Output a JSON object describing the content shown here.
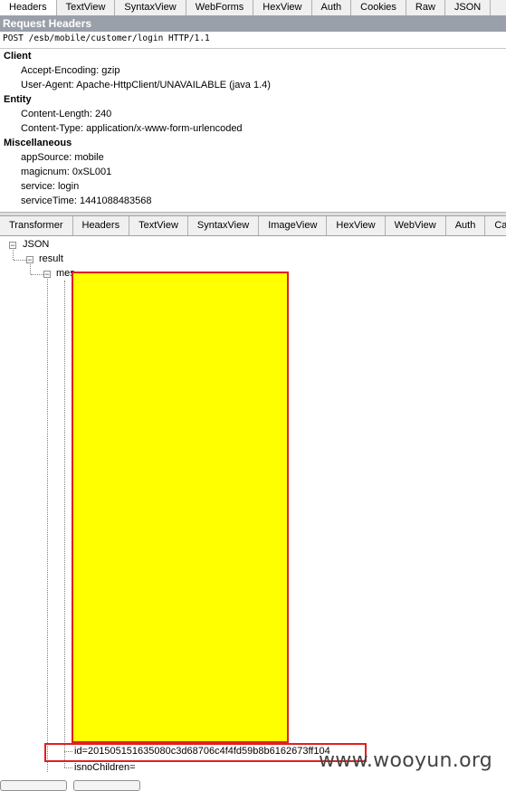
{
  "top_tabs": [
    "Headers",
    "TextView",
    "SyntaxView",
    "WebForms",
    "HexView",
    "Auth",
    "Cookies",
    "Raw",
    "JSON"
  ],
  "request_headers": {
    "title": "Request Headers",
    "request_line": "POST /esb/mobile/customer/login HTTP/1.1",
    "groups": [
      {
        "name": "Client",
        "items": [
          "Accept-Encoding: gzip",
          "User-Agent: Apache-HttpClient/UNAVAILABLE (java 1.4)"
        ]
      },
      {
        "name": "Entity",
        "items": [
          "Content-Length: 240",
          "Content-Type: application/x-www-form-urlencoded"
        ]
      },
      {
        "name": "Miscellaneous",
        "items": [
          "appSource: mobile",
          "magicnum: 0xSL001",
          "service: login",
          "serviceTime: 1441088483568"
        ]
      }
    ]
  },
  "bottom_tabs": [
    "Transformer",
    "Headers",
    "TextView",
    "SyntaxView",
    "ImageView",
    "HexView",
    "WebView",
    "Auth",
    "Cac"
  ],
  "tree": {
    "root": "JSON",
    "result": "result",
    "partial": "mes",
    "id_item": "id=201505151635080c3d68706c4f4fd59b8b6162673ff104",
    "children_item": "isnoChildren="
  },
  "watermark": "www.wooyun.org",
  "colors": {
    "redaction": "#ffff00",
    "highlight_border": "#e0201f",
    "header_bar": "#9aa0aa"
  }
}
